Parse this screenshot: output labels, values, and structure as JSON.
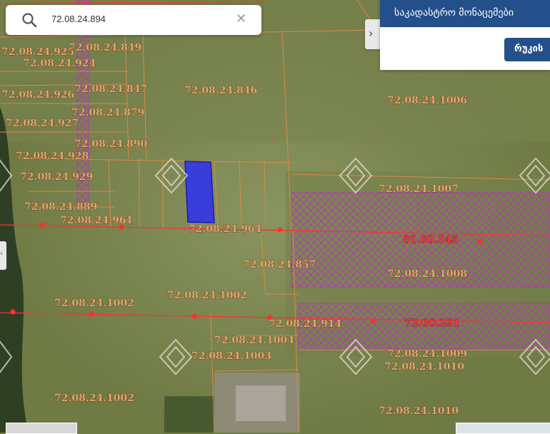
{
  "search": {
    "query": "72.08.24.894"
  },
  "panel": {
    "title": "საკადასტრო მონაცემები",
    "map_button": "რუკის"
  },
  "colors": {
    "panel_header": "#234f8a",
    "selected_parcel": "#2d2ff0",
    "parcel_line": "#d98a4a",
    "road_line": "#ff3030",
    "hatch": "#b23bb4"
  },
  "parcels": [
    "72.08.24.925",
    "72.08.24.849",
    "72.08.24.924",
    "72.08.24.926",
    "72.08.24.847",
    "72.08.24.846",
    "72.08.24.879",
    "72.08.24.927",
    "72.08.24.890",
    "72.08.24.928",
    "72.08.24.929",
    "72.08.24.889",
    "72.08.24.961",
    "72.08.24.964",
    "72.08.24.857",
    "72.08.24.1002",
    "72.08.24.1002",
    "72.08.24.914",
    "72.08.24.1004",
    "72.08.24.1003",
    "72.08.24.1002",
    "72.08.24.1006",
    "72.08.24.1007",
    "81.00.345",
    "72.08.24.1008",
    "72.00.291",
    "72.08.24.1009",
    "72.08.24.1010",
    "72.08.24.1010"
  ]
}
